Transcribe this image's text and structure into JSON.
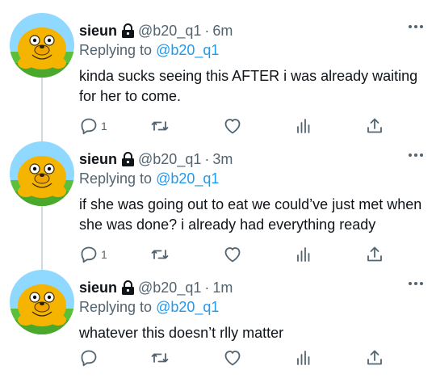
{
  "thread": {
    "tweets": [
      {
        "name": "sieun",
        "handle": "@b20_q1",
        "separator": "·",
        "time": "6m",
        "reply_prefix": "Replying to ",
        "reply_mention": "@b20_q1",
        "text": "kinda sucks seeing this AFTER i was already waiting for her to come.",
        "reply_count": "1"
      },
      {
        "name": "sieun",
        "handle": "@b20_q1",
        "separator": "·",
        "time": "3m",
        "reply_prefix": "Replying to ",
        "reply_mention": "@b20_q1",
        "text": "if she was going out to eat we could’ve just met when she was done? i already had everything ready",
        "reply_count": "1"
      },
      {
        "name": "sieun",
        "handle": "@b20_q1",
        "separator": "·",
        "time": "1m",
        "reply_prefix": "Replying to ",
        "reply_mention": "@b20_q1",
        "text": "whatever this doesn’t rlly matter",
        "reply_count": ""
      }
    ]
  },
  "icons": {
    "lock": "lock-icon",
    "more": "more-icon",
    "reply": "reply-icon",
    "retweet": "retweet-icon",
    "like": "heart-icon",
    "analytics": "analytics-icon",
    "share": "share-icon"
  },
  "colors": {
    "link": "#1d9bf0",
    "muted": "#536471",
    "text": "#0f1419",
    "avatar_sky": "#8fd8ff",
    "avatar_grass": "#5bbf3a",
    "avatar_jake": "#f5b400"
  }
}
